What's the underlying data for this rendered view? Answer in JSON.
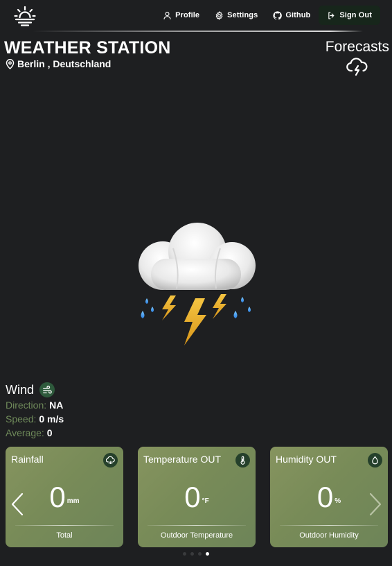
{
  "nav": {
    "logo_icon": "sunrise-icon",
    "links": [
      {
        "label": "Profile",
        "icon": "user-icon"
      },
      {
        "label": "Settings",
        "icon": "gear-icon"
      },
      {
        "label": "Github",
        "icon": "github-icon"
      },
      {
        "label": "Sign Out",
        "icon": "sign-out-icon"
      }
    ]
  },
  "header": {
    "title": "WEATHER STATION",
    "location": "Berlin , Deutschland",
    "location_icon": "map-pin-icon",
    "forecasts_label": "Forecasts",
    "forecasts_icon": "cloud-lightning-icon"
  },
  "weather": {
    "icon": "thunderstorm-icon"
  },
  "wind": {
    "title": "Wind",
    "icon": "wind-icon",
    "direction_label": "Direction:",
    "direction_value": "NA",
    "speed_label": "Speed:",
    "speed_value": "0 m/s",
    "average_label": "Average:",
    "average_value": "0"
  },
  "cards": [
    {
      "title": "Rainfall",
      "icon": "cloud-rain-icon",
      "value": "0",
      "unit": "mm",
      "footer": "Total"
    },
    {
      "title": "Temperature OUT",
      "icon": "thermometer-icon",
      "value": "0",
      "unit": "°F",
      "footer": "Outdoor Temperature"
    },
    {
      "title": "Humidity OUT",
      "icon": "droplet-icon",
      "value": "0",
      "unit": "%",
      "footer": "Outdoor Humidity"
    }
  ],
  "carousel": {
    "dot_count": 4,
    "active_dot": 4
  },
  "colors": {
    "background": "#1e1f21",
    "card_gradient_start": "#86945f",
    "card_gradient_end": "#6d8458",
    "badge_green": "#25402b",
    "label_green": "#6f8a5a",
    "signout_bg": "#17261b"
  }
}
